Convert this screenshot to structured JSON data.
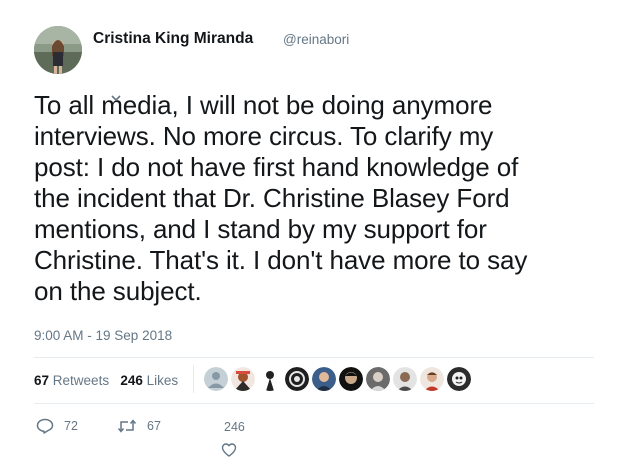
{
  "user": {
    "display_name": "Cristina King Miranda",
    "handle": "@reinabori"
  },
  "tweet": {
    "lines": [
      "To all media, I will not be doing anymore",
      "interviews. No more circus. To clarify my",
      "post: I do not have first hand knowledge of",
      "the incident that Dr. Christine Blasey Ford",
      "mentions, and I stand by my support for",
      "Christine. That's it. I don't have more to say",
      "on the subject."
    ],
    "timestamp": "9:00 AM - 19 Sep 2018"
  },
  "stats": {
    "retweets_count": "67",
    "retweets_label": "Retweets",
    "likes_count": "246",
    "likes_label": "Likes"
  },
  "actions": {
    "reply_count": "72",
    "retweet_count": "67",
    "like_count": "246"
  },
  "colors": {
    "text": "#14171a",
    "muted": "#657786",
    "divider": "#e6ecf0"
  },
  "icons": {
    "reply": "reply-icon",
    "retweet": "retweet-icon",
    "like": "heart-icon",
    "caret": "caret-down-icon"
  }
}
